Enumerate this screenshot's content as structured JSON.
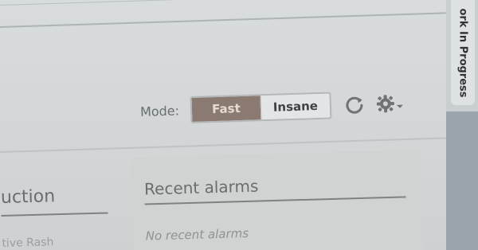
{
  "toolbar": {
    "mode_label": "Mode:",
    "mode_options": [
      "Fast",
      "Insane"
    ],
    "selected_mode": "Fast"
  },
  "panels": {
    "left_title_partial": "uction",
    "left_text_partial": "tive Rash",
    "alarms_title": "Recent alarms",
    "alarms_empty": "No recent alarms"
  },
  "side_tab": {
    "label": "ork In Progress"
  },
  "colors": {
    "background": "#d2d6d6",
    "active_mode": "#8a7a72",
    "inactive_mode": "#e3e6e6"
  },
  "icons": {
    "refresh": "refresh-icon",
    "settings": "gear-icon"
  }
}
